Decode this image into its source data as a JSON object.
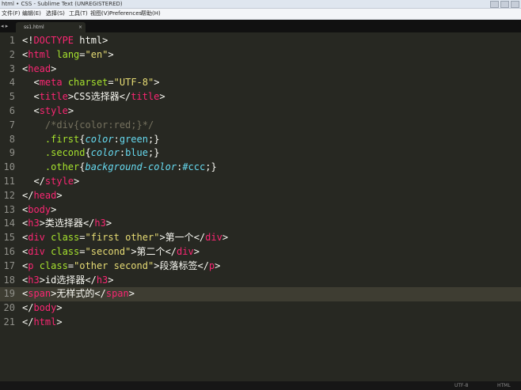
{
  "window": {
    "title": "html • CSS - Sublime Text (UNREGISTERED)"
  },
  "menu": [
    "文件(F)",
    "编辑(E)",
    "选择(S)",
    "工具(T)",
    "视图(V)",
    "Preferences",
    "帮助(H)"
  ],
  "tabs": {
    "nav": "◂ ▸",
    "active_label": "ss1.html",
    "close_glyph": "×"
  },
  "editor": {
    "current_line": 19,
    "lines": [
      {
        "n": "1",
        "tokens": [
          [
            "pn",
            "<!"
          ],
          [
            "tg",
            "DOCTYPE"
          ],
          [
            "tx",
            " html"
          ],
          [
            "pn",
            ">"
          ]
        ]
      },
      {
        "n": "2",
        "tokens": [
          [
            "pn",
            "<"
          ],
          [
            "tg",
            "html"
          ],
          [
            "tx",
            " "
          ],
          [
            "at",
            "lang"
          ],
          [
            "pn",
            "="
          ],
          [
            "st",
            "\"en\""
          ],
          [
            "pn",
            ">"
          ]
        ]
      },
      {
        "n": "3",
        "tokens": [
          [
            "pn",
            "<"
          ],
          [
            "tg",
            "head"
          ],
          [
            "pn",
            ">"
          ]
        ]
      },
      {
        "n": "4",
        "tokens": [
          [
            "tx",
            "  "
          ],
          [
            "pn",
            "<"
          ],
          [
            "tg",
            "meta"
          ],
          [
            "tx",
            " "
          ],
          [
            "at",
            "charset"
          ],
          [
            "pn",
            "="
          ],
          [
            "st",
            "\"UTF-8\""
          ],
          [
            "pn",
            ">"
          ]
        ]
      },
      {
        "n": "5",
        "tokens": [
          [
            "tx",
            "  "
          ],
          [
            "pn",
            "<"
          ],
          [
            "tg",
            "title"
          ],
          [
            "pn",
            ">"
          ],
          [
            "tx",
            "CSS选择器"
          ],
          [
            "pn",
            "</"
          ],
          [
            "tg",
            "title"
          ],
          [
            "pn",
            ">"
          ]
        ]
      },
      {
        "n": "6",
        "tokens": [
          [
            "tx",
            "  "
          ],
          [
            "pn",
            "<"
          ],
          [
            "tg",
            "style"
          ],
          [
            "pn",
            ">"
          ]
        ]
      },
      {
        "n": "7",
        "tokens": [
          [
            "tx",
            "    "
          ],
          [
            "cm",
            "/*div{color:red;}*/"
          ]
        ]
      },
      {
        "n": "8",
        "tokens": [
          [
            "tx",
            "    "
          ],
          [
            "at",
            ".first"
          ],
          [
            "pn",
            "{"
          ],
          [
            "pr",
            "color"
          ],
          [
            "pn",
            ":"
          ],
          [
            "vl",
            "green"
          ],
          [
            "pn",
            ";}"
          ]
        ]
      },
      {
        "n": "9",
        "tokens": [
          [
            "tx",
            "    "
          ],
          [
            "at",
            ".second"
          ],
          [
            "pn",
            "{"
          ],
          [
            "pr",
            "color"
          ],
          [
            "pn",
            ":"
          ],
          [
            "vl",
            "blue"
          ],
          [
            "pn",
            ";}"
          ]
        ]
      },
      {
        "n": "10",
        "tokens": [
          [
            "tx",
            "    "
          ],
          [
            "at",
            ".other"
          ],
          [
            "pn",
            "{"
          ],
          [
            "pr",
            "background-color"
          ],
          [
            "pn",
            ":"
          ],
          [
            "vl",
            "#ccc"
          ],
          [
            "pn",
            ";}"
          ]
        ]
      },
      {
        "n": "11",
        "tokens": [
          [
            "tx",
            "  "
          ],
          [
            "pn",
            "</"
          ],
          [
            "tg",
            "style"
          ],
          [
            "pn",
            ">"
          ]
        ]
      },
      {
        "n": "12",
        "tokens": [
          [
            "pn",
            "</"
          ],
          [
            "tg",
            "head"
          ],
          [
            "pn",
            ">"
          ]
        ]
      },
      {
        "n": "13",
        "tokens": [
          [
            "pn",
            "<"
          ],
          [
            "tg",
            "body"
          ],
          [
            "pn",
            ">"
          ]
        ]
      },
      {
        "n": "14",
        "tokens": [
          [
            "pn",
            "<"
          ],
          [
            "tg",
            "h3"
          ],
          [
            "pn",
            ">"
          ],
          [
            "tx",
            "类选择器"
          ],
          [
            "pn",
            "</"
          ],
          [
            "tg",
            "h3"
          ],
          [
            "pn",
            ">"
          ]
        ]
      },
      {
        "n": "15",
        "tokens": [
          [
            "pn",
            "<"
          ],
          [
            "tg",
            "div"
          ],
          [
            "tx",
            " "
          ],
          [
            "at",
            "class"
          ],
          [
            "pn",
            "="
          ],
          [
            "st",
            "\"first other\""
          ],
          [
            "pn",
            ">"
          ],
          [
            "tx",
            "第一个"
          ],
          [
            "pn",
            "</"
          ],
          [
            "tg",
            "div"
          ],
          [
            "pn",
            ">"
          ]
        ]
      },
      {
        "n": "16",
        "tokens": [
          [
            "pn",
            "<"
          ],
          [
            "tg",
            "div"
          ],
          [
            "tx",
            " "
          ],
          [
            "at",
            "class"
          ],
          [
            "pn",
            "="
          ],
          [
            "st",
            "\"second\""
          ],
          [
            "pn",
            ">"
          ],
          [
            "tx",
            "第二个"
          ],
          [
            "pn",
            "</"
          ],
          [
            "tg",
            "div"
          ],
          [
            "pn",
            ">"
          ]
        ]
      },
      {
        "n": "17",
        "tokens": [
          [
            "pn",
            "<"
          ],
          [
            "tg",
            "p"
          ],
          [
            "tx",
            " "
          ],
          [
            "at",
            "class"
          ],
          [
            "pn",
            "="
          ],
          [
            "st",
            "\"other second\""
          ],
          [
            "pn",
            ">"
          ],
          [
            "tx",
            "段落标签"
          ],
          [
            "pn",
            "</"
          ],
          [
            "tg",
            "p"
          ],
          [
            "pn",
            ">"
          ]
        ]
      },
      {
        "n": "18",
        "tokens": [
          [
            "pn",
            "<"
          ],
          [
            "tg",
            "h3"
          ],
          [
            "pn",
            ">"
          ],
          [
            "tx",
            "id选择器"
          ],
          [
            "pn",
            "</"
          ],
          [
            "tg",
            "h3"
          ],
          [
            "pn",
            ">"
          ]
        ]
      },
      {
        "n": "19",
        "tokens": [
          [
            "pn",
            "<"
          ],
          [
            "tg",
            "span"
          ],
          [
            "pn",
            ">"
          ],
          [
            "tx",
            "无样式的"
          ],
          [
            "pn",
            "</"
          ],
          [
            "tg",
            "span"
          ],
          [
            "pn",
            ">"
          ]
        ]
      },
      {
        "n": "20",
        "tokens": [
          [
            "pn",
            "</"
          ],
          [
            "tg",
            "body"
          ],
          [
            "pn",
            ">"
          ]
        ]
      },
      {
        "n": "21",
        "tokens": [
          [
            "pn",
            "</"
          ],
          [
            "tg",
            "html"
          ],
          [
            "pn",
            ">"
          ]
        ]
      }
    ]
  },
  "status": {
    "encoding": "UTF-8",
    "syntax": "HTML"
  },
  "colors": {
    "background": "#272822",
    "line_highlight": "#3e3d32",
    "gutter_text": "#90908a",
    "tag": "#f92672",
    "attribute": "#a6e22e",
    "string": "#e6db74",
    "comment": "#75715e",
    "property": "#66d9ef",
    "value": "#66d9ef",
    "text": "#f8f8f2"
  }
}
